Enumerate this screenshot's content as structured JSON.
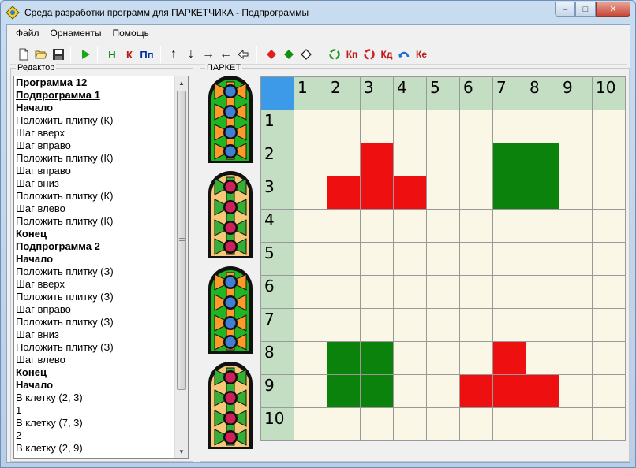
{
  "window": {
    "title": "Среда разработки программ для ПАРКЕТЧИКА - Подпрограммы",
    "buttons": {
      "minimize": "‒",
      "maximize": "□",
      "close": "✕"
    }
  },
  "menu": [
    "Файл",
    "Орнаменты",
    "Помощь"
  ],
  "toolbar": {
    "file": [
      "new-file-icon",
      "open-folder-icon",
      "save-disk-icon"
    ],
    "run": "play-icon",
    "cmd_letters": [
      "Н",
      "К",
      "Пп"
    ],
    "arrows": [
      "↑",
      "↓",
      "→",
      "←"
    ],
    "tile_colors": {
      "red": "#e02020",
      "green": "#109010",
      "empty": "#ffffff"
    },
    "ornament_labels": [
      "Кп",
      "Кд",
      "Ке"
    ],
    "colors": {
      "green_cmd": "#0a8a0a",
      "red_cmd": "#c01818",
      "blue_cmd": "#0030a0"
    }
  },
  "editor": {
    "label": "Редактор",
    "lines": [
      {
        "text": "Программа 12",
        "style": "ul"
      },
      {
        "text": "Подпрограмма 1",
        "style": "ul"
      },
      {
        "text": "Начало",
        "style": "bold"
      },
      {
        "text": "Положить плитку (К)",
        "style": ""
      },
      {
        "text": "Шаг вверх",
        "style": ""
      },
      {
        "text": "Шаг вправо",
        "style": ""
      },
      {
        "text": "Положить плитку (К)",
        "style": ""
      },
      {
        "text": "Шаг вправо",
        "style": ""
      },
      {
        "text": "Шаг вниз",
        "style": ""
      },
      {
        "text": "Положить плитку (К)",
        "style": ""
      },
      {
        "text": "Шаг влево",
        "style": ""
      },
      {
        "text": "Положить плитку (К)",
        "style": ""
      },
      {
        "text": "Конец",
        "style": "bold"
      },
      {
        "text": "Подпрограмма 2",
        "style": "ul"
      },
      {
        "text": "Начало",
        "style": "bold"
      },
      {
        "text": "Положить плитку (З)",
        "style": ""
      },
      {
        "text": "Шаг вверх",
        "style": ""
      },
      {
        "text": "Положить плитку (З)",
        "style": ""
      },
      {
        "text": "Шаг вправо",
        "style": ""
      },
      {
        "text": "Положить плитку (З)",
        "style": ""
      },
      {
        "text": "Шаг вниз",
        "style": ""
      },
      {
        "text": "Положить плитку (З)",
        "style": ""
      },
      {
        "text": "Шаг влево",
        "style": ""
      },
      {
        "text": "Конец",
        "style": "bold"
      },
      {
        "text": "Начало",
        "style": "bold"
      },
      {
        "text": "В клетку (2, 3)",
        "style": ""
      },
      {
        "text": "1",
        "style": ""
      },
      {
        "text": "В клетку (7, 3)",
        "style": ""
      },
      {
        "text": "2",
        "style": ""
      },
      {
        "text": "В клетку (2, 9)",
        "style": ""
      }
    ]
  },
  "parquet": {
    "label": "ПАРКЕТ",
    "tile_palettes": [
      {
        "outer": "#22b522",
        "inner": "#ff9a2a",
        "dots": "#3f7fd6"
      },
      {
        "outer": "#f6c878",
        "inner": "#34b034",
        "dots": "#d0205a"
      },
      {
        "outer": "#22b522",
        "inner": "#ff9a2a",
        "dots": "#3f7fd6"
      },
      {
        "outer": "#f6c878",
        "inner": "#34b034",
        "dots": "#d0205a"
      }
    ],
    "columns": [
      "1",
      "2",
      "3",
      "4",
      "5",
      "6",
      "7",
      "8",
      "9",
      "10"
    ],
    "rows": [
      "1",
      "2",
      "3",
      "4",
      "5",
      "6",
      "7",
      "8",
      "9",
      "10"
    ],
    "colors": {
      "red": "#ee1010",
      "green": "#0b820b",
      "empty": "#fbf7e7"
    },
    "filled_cells": [
      {
        "col": 3,
        "row": 2,
        "color": "red"
      },
      {
        "col": 2,
        "row": 3,
        "color": "red"
      },
      {
        "col": 3,
        "row": 3,
        "color": "red"
      },
      {
        "col": 4,
        "row": 3,
        "color": "red"
      },
      {
        "col": 7,
        "row": 2,
        "color": "green"
      },
      {
        "col": 8,
        "row": 2,
        "color": "green"
      },
      {
        "col": 7,
        "row": 3,
        "color": "green"
      },
      {
        "col": 8,
        "row": 3,
        "color": "green"
      },
      {
        "col": 2,
        "row": 8,
        "color": "green"
      },
      {
        "col": 3,
        "row": 8,
        "color": "green"
      },
      {
        "col": 2,
        "row": 9,
        "color": "green"
      },
      {
        "col": 3,
        "row": 9,
        "color": "green"
      },
      {
        "col": 7,
        "row": 8,
        "color": "red"
      },
      {
        "col": 6,
        "row": 9,
        "color": "red"
      },
      {
        "col": 7,
        "row": 9,
        "color": "red"
      },
      {
        "col": 8,
        "row": 9,
        "color": "red"
      }
    ]
  }
}
